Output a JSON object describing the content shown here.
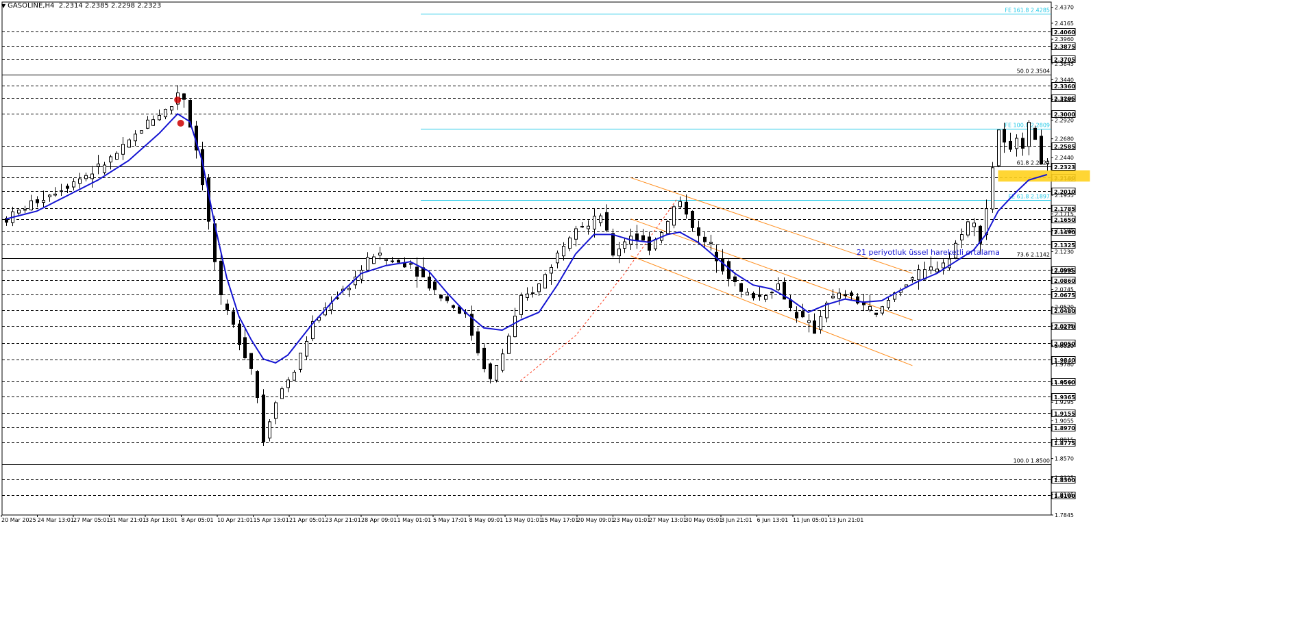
{
  "header": {
    "symbol": "GASOLINE,H4",
    "ohlc": "2.2314 2.2385 2.2298 2.2323"
  },
  "colors": {
    "candle": "#000000",
    "ema": "#1414d2",
    "channel": "#ff8c1a",
    "fibo_ext": "#1ec8e6",
    "fibo_ret": "#000000",
    "zone": "#ffd21e",
    "marker": "#cc0000",
    "annotation": "#1414d2"
  },
  "chart_data": {
    "type": "candlestick",
    "title": "GASOLINE,H4",
    "ylim": [
      1.7845,
      2.4437
    ],
    "y_ticks": [
      "2.4370",
      "2.4165",
      "2.3960",
      "2.3645",
      "2.3440",
      "2.3185",
      "2.2920",
      "2.2680",
      "2.2440",
      "2.2160",
      "2.1955",
      "2.1715",
      "2.1500",
      "2.1230",
      "2.0995",
      "2.0745",
      "2.0520",
      "2.0275",
      "2.0020",
      "1.9780",
      "1.9535",
      "1.9295",
      "1.9055",
      "1.8815",
      "1.8570",
      "1.8325",
      "1.8105",
      "1.7845"
    ],
    "x_ticks": [
      "20 Mar 2025",
      "24 Mar 13:01",
      "27 Mar 05:01",
      "31 Mar 21:01",
      "3 Apr 13:01",
      "8 Apr 05:01",
      "10 Apr 21:01",
      "15 Apr 13:01",
      "21 Apr 05:01",
      "23 Apr 21:01",
      "28 Apr 09:01",
      "1 May 01:01",
      "5 May 17:01",
      "8 May 09:01",
      "13 May 01:01",
      "15 May 17:01",
      "20 May 09:01",
      "23 May 01:01",
      "27 May 13:01",
      "30 May 05:01",
      "3 Jun 21:01",
      "6 Jun 13:01",
      "11 Jun 05:01",
      "13 Jun 21:01"
    ],
    "price_levels": [
      "2.4060",
      "2.3875",
      "2.3705",
      "2.3360",
      "2.3205",
      "2.3000",
      "2.2585",
      "2.2180",
      "2.2010",
      "2.1785",
      "2.1650",
      "2.1490",
      "2.1325",
      "2.0995",
      "2.0860",
      "2.0675",
      "2.0480",
      "2.0270",
      "2.0050",
      "1.9840",
      "1.9560",
      "1.9365",
      "1.9155",
      "1.8970",
      "1.8775",
      "1.8300",
      "1.8100"
    ],
    "current_price": "2.2323",
    "fibonacci_retracement": [
      {
        "label": "50.0 2.3504",
        "value": 2.3504
      },
      {
        "label": "61.8 2.2323",
        "value": 2.2323
      },
      {
        "label": "73.6 2.1142",
        "value": 2.1142
      },
      {
        "label": "100.0 1.8500",
        "value": 1.85
      }
    ],
    "fibonacci_expansion": [
      {
        "label": "FE 161.8 2.4285",
        "value": 2.4285
      },
      {
        "label": "FE 100.0 2.2809",
        "value": 2.2809
      },
      {
        "label": "FE 61.8 2.1897",
        "value": 2.1897
      }
    ],
    "ema_label": "21 periyotluk üssel hareketli ortalama",
    "price_path": [
      [
        0,
        2.165
      ],
      [
        4,
        2.185
      ],
      [
        9,
        2.205
      ],
      [
        15,
        2.23
      ],
      [
        19,
        2.255
      ],
      [
        23,
        2.29
      ],
      [
        27,
        2.31
      ],
      [
        28.5,
        2.338
      ],
      [
        30,
        2.285
      ],
      [
        31.5,
        2.24
      ],
      [
        33,
        2.16
      ],
      [
        35,
        2.06
      ],
      [
        38,
        2.01
      ],
      [
        40.5,
        1.965
      ],
      [
        42,
        1.88
      ],
      [
        44,
        1.935
      ],
      [
        47,
        1.97
      ],
      [
        50,
        2.03
      ],
      [
        53,
        2.06
      ],
      [
        56,
        2.08
      ],
      [
        58,
        2.1
      ],
      [
        60,
        2.12
      ],
      [
        63,
        2.11
      ],
      [
        66,
        2.108
      ],
      [
        69,
        2.08
      ],
      [
        72,
        2.06
      ],
      [
        75,
        2.04
      ],
      [
        77,
        1.995
      ],
      [
        79,
        1.958
      ],
      [
        81,
        1.992
      ],
      [
        84,
        2.06
      ],
      [
        87,
        2.08
      ],
      [
        90,
        2.12
      ],
      [
        93,
        2.16
      ],
      [
        95,
        2.155
      ],
      [
        97,
        2.17
      ],
      [
        99,
        2.12
      ],
      [
        102,
        2.145
      ],
      [
        105,
        2.13
      ],
      [
        108,
        2.16
      ],
      [
        109.5,
        2.19
      ],
      [
        111,
        2.175
      ],
      [
        113,
        2.14
      ],
      [
        115,
        2.13
      ],
      [
        117,
        2.105
      ],
      [
        120,
        2.07
      ],
      [
        123,
        2.065
      ],
      [
        126,
        2.08
      ],
      [
        128,
        2.05
      ],
      [
        130,
        2.035
      ],
      [
        132,
        2.022
      ],
      [
        134,
        2.06
      ],
      [
        137,
        2.068
      ],
      [
        140,
        2.055
      ],
      [
        142,
        2.04
      ],
      [
        145,
        2.07
      ],
      [
        148,
        2.09
      ],
      [
        151,
        2.1
      ],
      [
        154,
        2.115
      ],
      [
        156,
        2.15
      ],
      [
        157.5,
        2.165
      ],
      [
        159,
        2.14
      ],
      [
        160.5,
        2.2
      ],
      [
        161.5,
        2.263
      ],
      [
        162.5,
        2.298
      ],
      [
        163.5,
        2.22
      ],
      [
        164.5,
        2.28
      ],
      [
        166,
        2.262
      ],
      [
        167.5,
        2.294
      ],
      [
        168.5,
        2.245
      ],
      [
        169.5,
        2.235
      ],
      [
        170,
        2.2323
      ]
    ],
    "ema_path": [
      [
        0,
        2.165
      ],
      [
        5,
        2.175
      ],
      [
        10,
        2.195
      ],
      [
        15,
        2.215
      ],
      [
        20,
        2.24
      ],
      [
        25,
        2.275
      ],
      [
        28,
        2.3
      ],
      [
        30,
        2.29
      ],
      [
        32,
        2.24
      ],
      [
        34,
        2.16
      ],
      [
        36,
        2.09
      ],
      [
        38,
        2.04
      ],
      [
        40,
        2.01
      ],
      [
        42,
        1.985
      ],
      [
        44,
        1.98
      ],
      [
        46,
        1.99
      ],
      [
        50,
        2.03
      ],
      [
        54,
        2.065
      ],
      [
        58,
        2.095
      ],
      [
        62,
        2.105
      ],
      [
        66,
        2.11
      ],
      [
        69,
        2.098
      ],
      [
        72,
        2.07
      ],
      [
        75,
        2.045
      ],
      [
        78,
        2.025
      ],
      [
        81,
        2.022
      ],
      [
        84,
        2.035
      ],
      [
        87,
        2.045
      ],
      [
        90,
        2.08
      ],
      [
        93,
        2.12
      ],
      [
        96,
        2.145
      ],
      [
        99,
        2.145
      ],
      [
        102,
        2.138
      ],
      [
        105,
        2.135
      ],
      [
        108,
        2.145
      ],
      [
        110,
        2.148
      ],
      [
        113,
        2.135
      ],
      [
        116,
        2.115
      ],
      [
        119,
        2.095
      ],
      [
        122,
        2.08
      ],
      [
        125,
        2.075
      ],
      [
        128,
        2.062
      ],
      [
        131,
        2.045
      ],
      [
        134,
        2.055
      ],
      [
        137,
        2.062
      ],
      [
        140,
        2.058
      ],
      [
        143,
        2.06
      ],
      [
        146,
        2.073
      ],
      [
        149,
        2.085
      ],
      [
        152,
        2.095
      ],
      [
        155,
        2.11
      ],
      [
        158,
        2.125
      ],
      [
        160,
        2.145
      ],
      [
        162,
        2.175
      ],
      [
        165,
        2.2
      ],
      [
        167,
        2.215
      ],
      [
        170,
        2.222
      ]
    ],
    "channel_lines": [
      {
        "from": [
          102,
          2.218
        ],
        "to": [
          148,
          2.095
        ]
      },
      {
        "from": [
          102,
          2.1175
        ],
        "to": [
          148,
          1.9765
        ]
      },
      {
        "from": [
          102,
          2.165
        ],
        "to": [
          148,
          2.035
        ]
      }
    ],
    "zigzag": [
      [
        84,
        1.957
      ],
      [
        93,
        2.015
      ],
      [
        101,
        2.095
      ],
      [
        109.5,
        2.19
      ]
    ],
    "zone": {
      "from_x": 162,
      "to_x": 177,
      "y_low": 2.213,
      "y_high": 2.2275
    },
    "markers": [
      {
        "x": 28,
        "y": 2.318
      },
      {
        "x": 28.5,
        "y": 2.288
      }
    ]
  }
}
